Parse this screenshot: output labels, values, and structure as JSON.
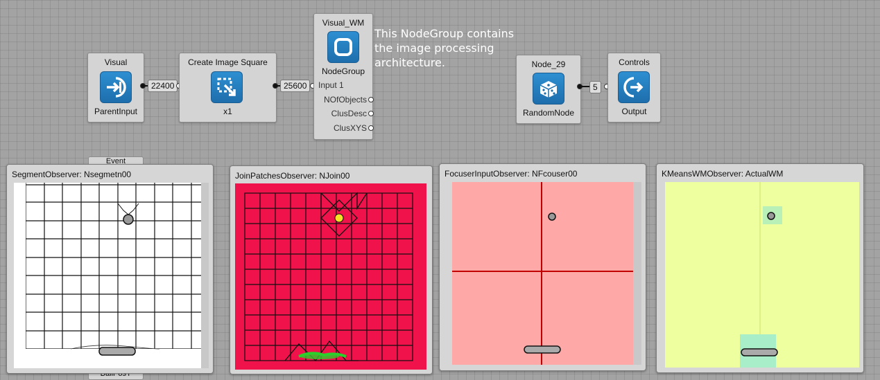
{
  "nodes": {
    "visual": {
      "title": "Visual",
      "subtitle": "ParentInput",
      "icon": "parent-input-icon"
    },
    "create_image": {
      "title": "Create Image Square",
      "subtitle": "x1",
      "icon": "image-resize-icon"
    },
    "visual_wm": {
      "title": "Visual_WM",
      "subtitle": "NodeGroup",
      "icon": "nodegroup-icon",
      "inputs": [
        "Input 1"
      ],
      "outputs": [
        "NOfObjects",
        "ClusDesc",
        "ClusXYS"
      ]
    },
    "node29": {
      "title": "Node_29",
      "subtitle": "RandomNode",
      "icon": "dice-icon"
    },
    "controls": {
      "title": "Controls",
      "subtitle": "Output",
      "icon": "output-icon"
    }
  },
  "connections": {
    "c1": "22400",
    "c2": "25600",
    "c3": "5"
  },
  "comment": {
    "text": "This NodeGroup contains\nthe image processing\narchitecture."
  },
  "hidden_nodes": {
    "top": "Event",
    "bottom": "BallPosY"
  },
  "observers": [
    {
      "title": "SegmentObserver: Nsegmetn00",
      "background": "#ffffff"
    },
    {
      "title": "JoinPatchesObserver: NJoin00",
      "background": "#f0124a"
    },
    {
      "title": "FocuserInputObserver: NFcouser00",
      "background": "#ffa8a8"
    },
    {
      "title": "KMeansWMObserver: ActualWM",
      "background": "#eeffa0"
    }
  ]
}
